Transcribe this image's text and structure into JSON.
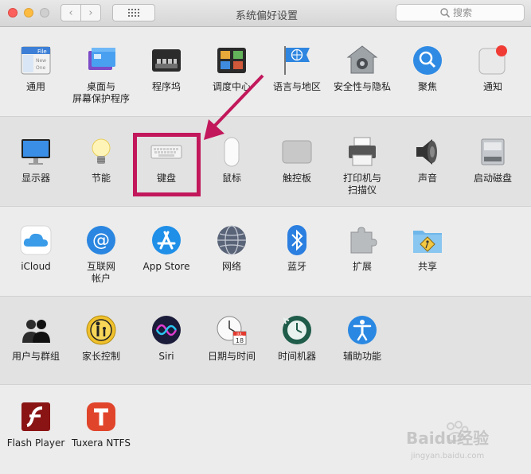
{
  "window": {
    "title": "系统偏好设置"
  },
  "toolbar": {
    "back_label": "‹",
    "forward_label": "›"
  },
  "search": {
    "placeholder": "搜索"
  },
  "rows": {
    "r1": [
      "通用",
      "桌面与屏幕保护程序",
      "程序坞",
      "调度中心",
      "语言与地区",
      "安全性与隐私",
      "聚焦",
      "通知"
    ],
    "r2": [
      "显示器",
      "节能",
      "键盘",
      "鼠标",
      "触控板",
      "打印机与扫描仪",
      "声音",
      "启动磁盘"
    ],
    "r3": [
      "iCloud",
      "互联网帐户",
      "App Store",
      "网络",
      "蓝牙",
      "扩展",
      "共享"
    ],
    "r4": [
      "用户与群组",
      "家长控制",
      "Siri",
      "日期与时间",
      "时间机器",
      "辅助功能"
    ],
    "r5": [
      "Flash Player",
      "Tuxera NTFS"
    ]
  },
  "labels": {
    "desktop_l1": "桌面与",
    "desktop_l2": "屏幕保护程序",
    "printer_l1": "打印机与",
    "printer_l2": "扫描仪",
    "internet_l1": "互联网",
    "internet_l2": "帐户"
  },
  "icon_text": {
    "general_file": "File",
    "general_new": "New",
    "general_open": "One",
    "calendar_month": "JUL",
    "calendar_day": "18"
  },
  "watermark": {
    "brand": "Baidu经验",
    "url": "jingyan.baidu.com"
  },
  "colors": {
    "highlight": "#c2185b",
    "accent": "#1e88e5"
  }
}
